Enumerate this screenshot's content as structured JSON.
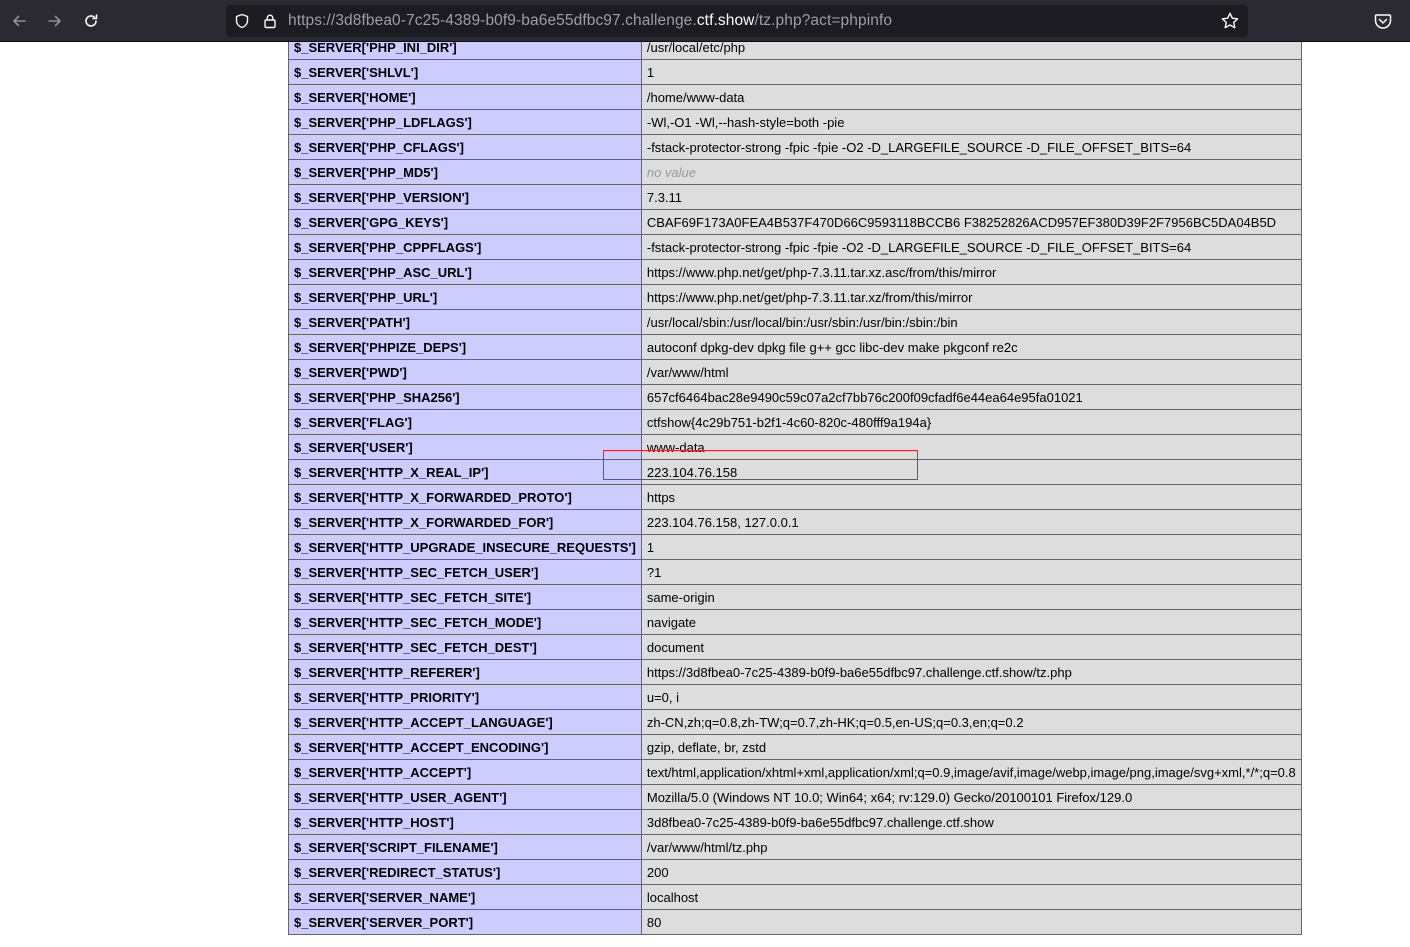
{
  "browser": {
    "url_prefix": "https://3d8fbea0-7c25-4389-b0f9-ba6e55dfbc97.challenge.",
    "url_host": "ctf.show",
    "url_suffix": "/tz.php?act=phpinfo",
    "icons": [
      "back-arrow-icon",
      "forward-arrow-icon",
      "reload-icon",
      "shield-icon",
      "lock-icon",
      "star-icon",
      "pocket-icon"
    ]
  },
  "highlight_color": "#e0262b",
  "rows": [
    {
      "key": "$_SERVER['PHP_INI_DIR']",
      "value": "/usr/local/etc/php"
    },
    {
      "key": "$_SERVER['SHLVL']",
      "value": "1"
    },
    {
      "key": "$_SERVER['HOME']",
      "value": "/home/www-data"
    },
    {
      "key": "$_SERVER['PHP_LDFLAGS']",
      "value": "-Wl,-O1 -Wl,--hash-style=both -pie"
    },
    {
      "key": "$_SERVER['PHP_CFLAGS']",
      "value": "-fstack-protector-strong -fpic -fpie -O2 -D_LARGEFILE_SOURCE -D_FILE_OFFSET_BITS=64"
    },
    {
      "key": "$_SERVER['PHP_MD5']",
      "value": "no value",
      "novalue": true
    },
    {
      "key": "$_SERVER['PHP_VERSION']",
      "value": "7.3.11"
    },
    {
      "key": "$_SERVER['GPG_KEYS']",
      "value": "CBAF69F173A0FEA4B537F470D66C9593118BCCB6 F38252826ACD957EF380D39F2F7956BC5DA04B5D"
    },
    {
      "key": "$_SERVER['PHP_CPPFLAGS']",
      "value": "-fstack-protector-strong -fpic -fpie -O2 -D_LARGEFILE_SOURCE -D_FILE_OFFSET_BITS=64"
    },
    {
      "key": "$_SERVER['PHP_ASC_URL']",
      "value": "https://www.php.net/get/php-7.3.11.tar.xz.asc/from/this/mirror"
    },
    {
      "key": "$_SERVER['PHP_URL']",
      "value": "https://www.php.net/get/php-7.3.11.tar.xz/from/this/mirror"
    },
    {
      "key": "$_SERVER['PATH']",
      "value": "/usr/local/sbin:/usr/local/bin:/usr/sbin:/usr/bin:/sbin:/bin"
    },
    {
      "key": "$_SERVER['PHPIZE_DEPS']",
      "value": "autoconf dpkg-dev dpkg file g++ gcc libc-dev make pkgconf re2c"
    },
    {
      "key": "$_SERVER['PWD']",
      "value": "/var/www/html"
    },
    {
      "key": "$_SERVER['PHP_SHA256']",
      "value": "657cf6464bac28e9490c59c07a2cf7bb76c200f09cfadf6e44ea64e95fa01021"
    },
    {
      "key": "$_SERVER['FLAG']",
      "value": "ctfshow{4c29b751-b2f1-4c60-820c-480fff9a194a}",
      "highlighted": true
    },
    {
      "key": "$_SERVER['USER']",
      "value": "www-data"
    },
    {
      "key": "$_SERVER['HTTP_X_REAL_IP']",
      "value": "223.104.76.158"
    },
    {
      "key": "$_SERVER['HTTP_X_FORWARDED_PROTO']",
      "value": "https"
    },
    {
      "key": "$_SERVER['HTTP_X_FORWARDED_FOR']",
      "value": "223.104.76.158, 127.0.0.1"
    },
    {
      "key": "$_SERVER['HTTP_UPGRADE_INSECURE_REQUESTS']",
      "value": "1"
    },
    {
      "key": "$_SERVER['HTTP_SEC_FETCH_USER']",
      "value": "?1"
    },
    {
      "key": "$_SERVER['HTTP_SEC_FETCH_SITE']",
      "value": "same-origin"
    },
    {
      "key": "$_SERVER['HTTP_SEC_FETCH_MODE']",
      "value": "navigate"
    },
    {
      "key": "$_SERVER['HTTP_SEC_FETCH_DEST']",
      "value": "document"
    },
    {
      "key": "$_SERVER['HTTP_REFERER']",
      "value": "https://3d8fbea0-7c25-4389-b0f9-ba6e55dfbc97.challenge.ctf.show/tz.php"
    },
    {
      "key": "$_SERVER['HTTP_PRIORITY']",
      "value": "u=0, i"
    },
    {
      "key": "$_SERVER['HTTP_ACCEPT_LANGUAGE']",
      "value": "zh-CN,zh;q=0.8,zh-TW;q=0.7,zh-HK;q=0.5,en-US;q=0.3,en;q=0.2"
    },
    {
      "key": "$_SERVER['HTTP_ACCEPT_ENCODING']",
      "value": "gzip, deflate, br, zstd"
    },
    {
      "key": "$_SERVER['HTTP_ACCEPT']",
      "value": "text/html,application/xhtml+xml,application/xml;q=0.9,image/avif,image/webp,image/png,image/svg+xml,*/*;q=0.8"
    },
    {
      "key": "$_SERVER['HTTP_USER_AGENT']",
      "value": "Mozilla/5.0 (Windows NT 10.0; Win64; x64; rv:129.0) Gecko/20100101 Firefox/129.0"
    },
    {
      "key": "$_SERVER['HTTP_HOST']",
      "value": "3d8fbea0-7c25-4389-b0f9-ba6e55dfbc97.challenge.ctf.show"
    },
    {
      "key": "$_SERVER['SCRIPT_FILENAME']",
      "value": "/var/www/html/tz.php"
    },
    {
      "key": "$_SERVER['REDIRECT_STATUS']",
      "value": "200"
    },
    {
      "key": "$_SERVER['SERVER_NAME']",
      "value": "localhost"
    },
    {
      "key": "$_SERVER['SERVER_PORT']",
      "value": "80"
    }
  ]
}
